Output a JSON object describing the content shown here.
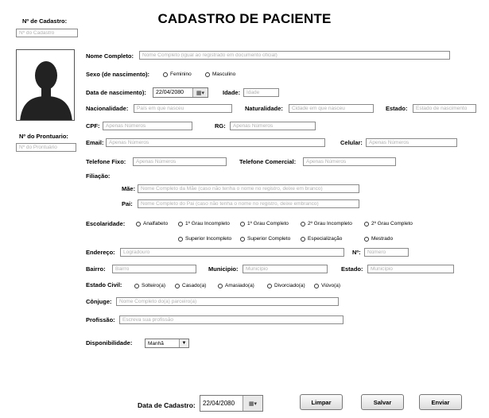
{
  "title": "CADASTRO DE PACIENTE",
  "cadastro_num": {
    "label": "Nº de Cadastro:",
    "placeholder": "Nº do Cadastro"
  },
  "prontuario_num": {
    "label": "Nº do Prontuario:",
    "placeholder": "Nº do Prontuário"
  },
  "nome": {
    "label": "Nome Completo:",
    "placeholder": "Nome Completo (igual ao registrado em documento oficial)"
  },
  "sexo": {
    "label": "Sexo (de nascimento):",
    "options": [
      "Feminino",
      "Masculino"
    ]
  },
  "nascimento": {
    "label": "Data de nascimento):",
    "value": "22/04/2080"
  },
  "idade": {
    "label": "Idade:",
    "placeholder": "Idade"
  },
  "nacionalidade": {
    "label": "Nacionalidade:",
    "placeholder": "País em que nasceu"
  },
  "naturalidade": {
    "label": "Naturalidade:",
    "placeholder": "Cidade em que nasceu"
  },
  "estado_nasc": {
    "label": "Estado:",
    "placeholder": "Estado de nascimento"
  },
  "cpf": {
    "label": "CPF:",
    "placeholder": "Apenas Números"
  },
  "rg": {
    "label": "RG:",
    "placeholder": "Apenas Números"
  },
  "email": {
    "label": "Email:",
    "placeholder": "Apenas Números"
  },
  "celular": {
    "label": "Celular:",
    "placeholder": "Apenas Números"
  },
  "tel_fixo": {
    "label": "Telefone Fixo:",
    "placeholder": "Apenas Números"
  },
  "tel_comercial": {
    "label": "Telefone Comercial:",
    "placeholder": "Apenas Números"
  },
  "filiacao": {
    "label": "Filiação:"
  },
  "mae": {
    "label": "Mãe:",
    "placeholder": "Nome Completo da Mãe (caso não tenha o nome no registro, deixe em branco)"
  },
  "pai": {
    "label": "Pai:",
    "placeholder": "Nome Completo do Pai (caso não tenha o nome no registro, deixe embranco)"
  },
  "escolaridade": {
    "label": "Escolaridade:",
    "options": [
      "Analfabeto",
      "1º Grau Incompleto",
      "1º Grau Completo",
      "2º Grau Incompleto",
      "2º Grau Completo",
      "Superior Incompleto",
      "Superior Completo",
      "Especialização",
      "Mestrado"
    ]
  },
  "endereco": {
    "label": "Endereço:",
    "placeholder": "Logradouro"
  },
  "numero": {
    "label": "Nº:",
    "placeholder": "Número"
  },
  "bairro": {
    "label": "Bairro:",
    "placeholder": "Bairro"
  },
  "municipio": {
    "label": "Municipio:",
    "placeholder": "Município"
  },
  "estado_end": {
    "label": "Estado:",
    "placeholder": "Município"
  },
  "estado_civil": {
    "label": "Estado Civil:",
    "options": [
      "Solteiro(a)",
      "Casado(a)",
      "Amasiado(a)",
      "Divorciado(a)",
      "Viúvo(a)"
    ]
  },
  "conjuge": {
    "label": "Cônjuge:",
    "placeholder": "Nome Completo do(a) parceiro(a)"
  },
  "profissao": {
    "label": "Profissão:",
    "placeholder": "Escreva sua profissão"
  },
  "disponibilidade": {
    "label": "Disponibilidade:",
    "value": "Manhã"
  },
  "data_cadastro": {
    "label": "Data de Cadastro:",
    "value": "22/04/2080"
  },
  "buttons": {
    "limpar": "Limpar",
    "salvar": "Salvar",
    "enviar": "Enviar"
  }
}
